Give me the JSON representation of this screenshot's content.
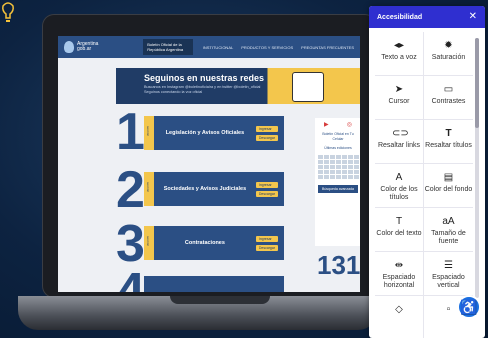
{
  "website": {
    "logo_text": "Argentina\ngob.ar",
    "tag": "Boletín Oficial de la República Argentina",
    "nav": [
      "INSTITUCIONAL",
      "PRODUCTOS Y SERVICIOS",
      "PREGUNTAS FRECUENTES"
    ],
    "banner": {
      "title": "Seguinos en nuestras redes",
      "subtitle": "Buscanos en Instagram @boletinoficialra y en twitter @boletin_oficial Seguinos conectando la voz oficial"
    },
    "cards": [
      {
        "number": "1",
        "stripe": "sección",
        "title": "Legislación y Avisos Oficiales",
        "btn1": "Ingresar",
        "btn2": "Descargar"
      },
      {
        "number": "2",
        "stripe": "sección",
        "title": "Sociedades y Avisos Judiciales",
        "btn1": "Ingresar",
        "btn2": "Descargar"
      },
      {
        "number": "3",
        "stripe": "sección",
        "title": "Contrataciones",
        "btn1": "Ingresar",
        "btn2": "Descargar"
      },
      {
        "number": "4",
        "stripe": "",
        "title": "",
        "btn1": "",
        "btn2": ""
      }
    ],
    "side": {
      "text": "Boletín Oficial en Tu Celular",
      "cal_title": "Últimas ediciones",
      "button": "Búsqueda avanzada",
      "counter": "131"
    }
  },
  "accessibility": {
    "title": "Accesibilidad",
    "close_icon": "close-icon",
    "items": [
      {
        "icon": "text-to-speech-icon",
        "label": "Texto a voz"
      },
      {
        "icon": "saturation-icon",
        "label": "Saturación"
      },
      {
        "icon": "cursor-icon",
        "label": "Cursor"
      },
      {
        "icon": "contrast-icon",
        "label": "Contrastes"
      },
      {
        "icon": "link-icon",
        "label": "Resaltar links"
      },
      {
        "icon": "title-icon",
        "label": "Resaltar títulos"
      },
      {
        "icon": "title-color-icon",
        "label": "Color de los títulos"
      },
      {
        "icon": "background-color-icon",
        "label": "Color del fondo"
      },
      {
        "icon": "text-color-icon",
        "label": "Color del texto"
      },
      {
        "icon": "font-size-icon",
        "label": "Tamaño de fuente"
      },
      {
        "icon": "horizontal-spacing-icon",
        "label": "Espaciado horizontal"
      },
      {
        "icon": "vertical-spacing-icon",
        "label": "Espaciado vertical"
      },
      {
        "icon": "more-icon",
        "label": ""
      },
      {
        "icon": "more-icon-2",
        "label": ""
      }
    ],
    "fab_icon": "accessibility-person-icon"
  },
  "colors": {
    "background": "#0d2341",
    "site_blue": "#2b4f84",
    "site_yellow": "#f3c64c",
    "panel_header": "#2f2fd0",
    "fab": "#1a6fe0"
  }
}
